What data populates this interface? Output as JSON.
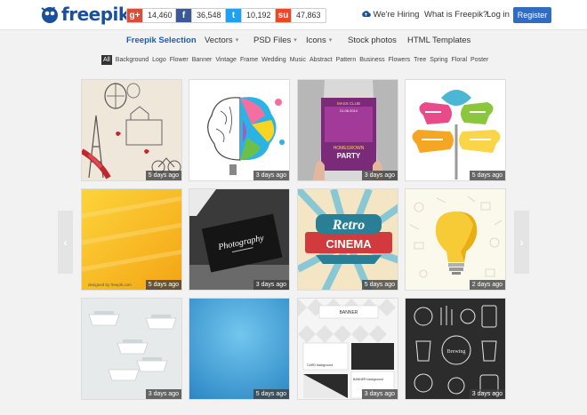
{
  "header": {
    "logo_text": "freepik",
    "social": [
      {
        "icon": "google-plus-icon",
        "glyph": "g+",
        "count": "14,460",
        "color": "#dd4b39"
      },
      {
        "icon": "facebook-icon",
        "glyph": "f",
        "count": "36,548",
        "color": "#3b5998"
      },
      {
        "icon": "twitter-icon",
        "glyph": "t",
        "count": "10,192",
        "color": "#1da1f2"
      },
      {
        "icon": "stumbleupon-icon",
        "glyph": "su",
        "count": "47,863",
        "color": "#eb4924"
      }
    ],
    "hiring": "We're Hiring",
    "what_is": "What is Freepik?",
    "login": "Log in",
    "register": "Register"
  },
  "nav": {
    "freepik_selection": "Freepik Selection",
    "vectors": "Vectors",
    "psd_files": "PSD Files",
    "icons": "Icons",
    "stock_photos": "Stock photos",
    "html_templates": "HTML Templates"
  },
  "tags": [
    "All",
    "Background",
    "Logo",
    "Flower",
    "Banner",
    "Vintage",
    "Frame",
    "Wedding",
    "Music",
    "Abstract",
    "Pattern",
    "Business",
    "Flowers",
    "Tree",
    "Spring",
    "Floral",
    "Poster"
  ],
  "tiles": [
    {
      "stamp": "5 days ago"
    },
    {
      "stamp": "3 days ago"
    },
    {
      "stamp": "3 days ago"
    },
    {
      "stamp": "5 days ago"
    },
    {
      "stamp": "5 days ago"
    },
    {
      "stamp": "3 days ago"
    },
    {
      "stamp": "5 days ago"
    },
    {
      "stamp": "2 days ago"
    },
    {
      "stamp": "3 days ago"
    },
    {
      "stamp": "5 days ago"
    },
    {
      "stamp": "3 days ago"
    },
    {
      "stamp": "3 days ago"
    }
  ],
  "tile_text": {
    "poster_line1": "MASS CLUB",
    "poster_line2": "21.06.2014",
    "poster_line3": "HOMEGROWN",
    "poster_line4": "PARTY",
    "card_text": "Photography",
    "retro": "Retro",
    "cinema": "CINEMA",
    "banner": "BANNER",
    "card_bg": "CARD background",
    "banner_bg": "BANNER background",
    "designed_by": "designed by freepik.com"
  },
  "colors": {
    "brand_blue": "#1a4f9a",
    "register_blue": "#2f6cc2",
    "active_nav": "#1a5bbd"
  }
}
